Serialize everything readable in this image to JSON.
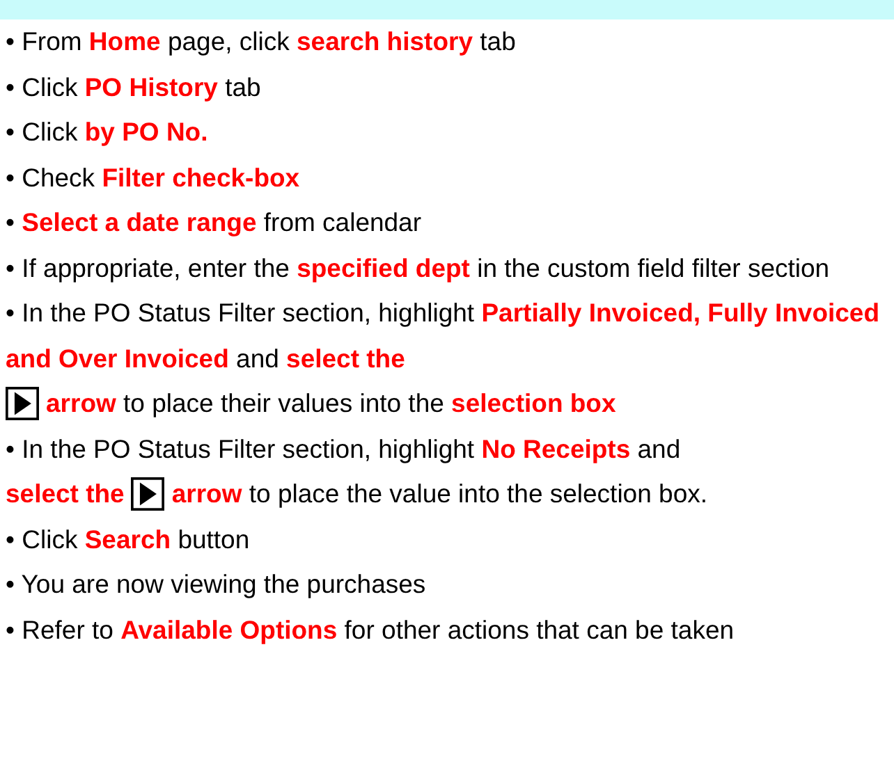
{
  "header": {
    "band": true
  },
  "steps": [
    {
      "lines": [
        [
          {
            "kind": "text",
            "text": "• From **Home** page, click **search history** tab"
          }
        ]
      ]
    },
    {
      "lines": [
        [
          {
            "kind": "text",
            "text": "• Click **PO History** tab"
          }
        ]
      ]
    },
    {
      "lines": [
        [
          {
            "kind": "text",
            "text": "• Click **by PO No.**"
          }
        ]
      ]
    },
    {
      "lines": [
        [
          {
            "kind": "text",
            "text": "• Check **Filter check-box**"
          }
        ]
      ]
    },
    {
      "lines": [
        [
          {
            "kind": "text",
            "text": "• **Select a date range** from calendar"
          }
        ]
      ]
    },
    {
      "lines": [
        [
          {
            "kind": "text",
            "text": "• If appropriate, enter the **specified dept** in the custom field filter section"
          }
        ]
      ]
    },
    {
      "lines": [
        [
          {
            "kind": "text",
            "text": "• In the PO Status Filter section, highlight **Partially Invoiced, Fully Invoiced and Over Invoiced** and **select the**"
          }
        ],
        [
          {
            "kind": "arrow"
          },
          {
            "kind": "text",
            "text": "**arrow** to place their values into the **selection box**"
          }
        ]
      ]
    },
    {
      "lines": [
        [
          {
            "kind": "text",
            "text": "• In the PO Status Filter section, highlight **No Receipts** and"
          }
        ],
        [
          {
            "kind": "text",
            "text": "**select the**"
          },
          {
            "kind": "arrow"
          },
          {
            "kind": "text",
            "text": "**arrow** to place the value into the selection box."
          }
        ]
      ]
    },
    {
      "lines": [
        [
          {
            "kind": "text",
            "text": "• Click **Search** button"
          }
        ]
      ]
    },
    {
      "lines": [
        [
          {
            "kind": "text",
            "text": "• You are now viewing the purchases"
          }
        ]
      ]
    },
    {
      "lines": [
        [
          {
            "kind": "text",
            "text": "• Refer to **Available Options** for other actions that can be taken"
          }
        ]
      ]
    }
  ]
}
